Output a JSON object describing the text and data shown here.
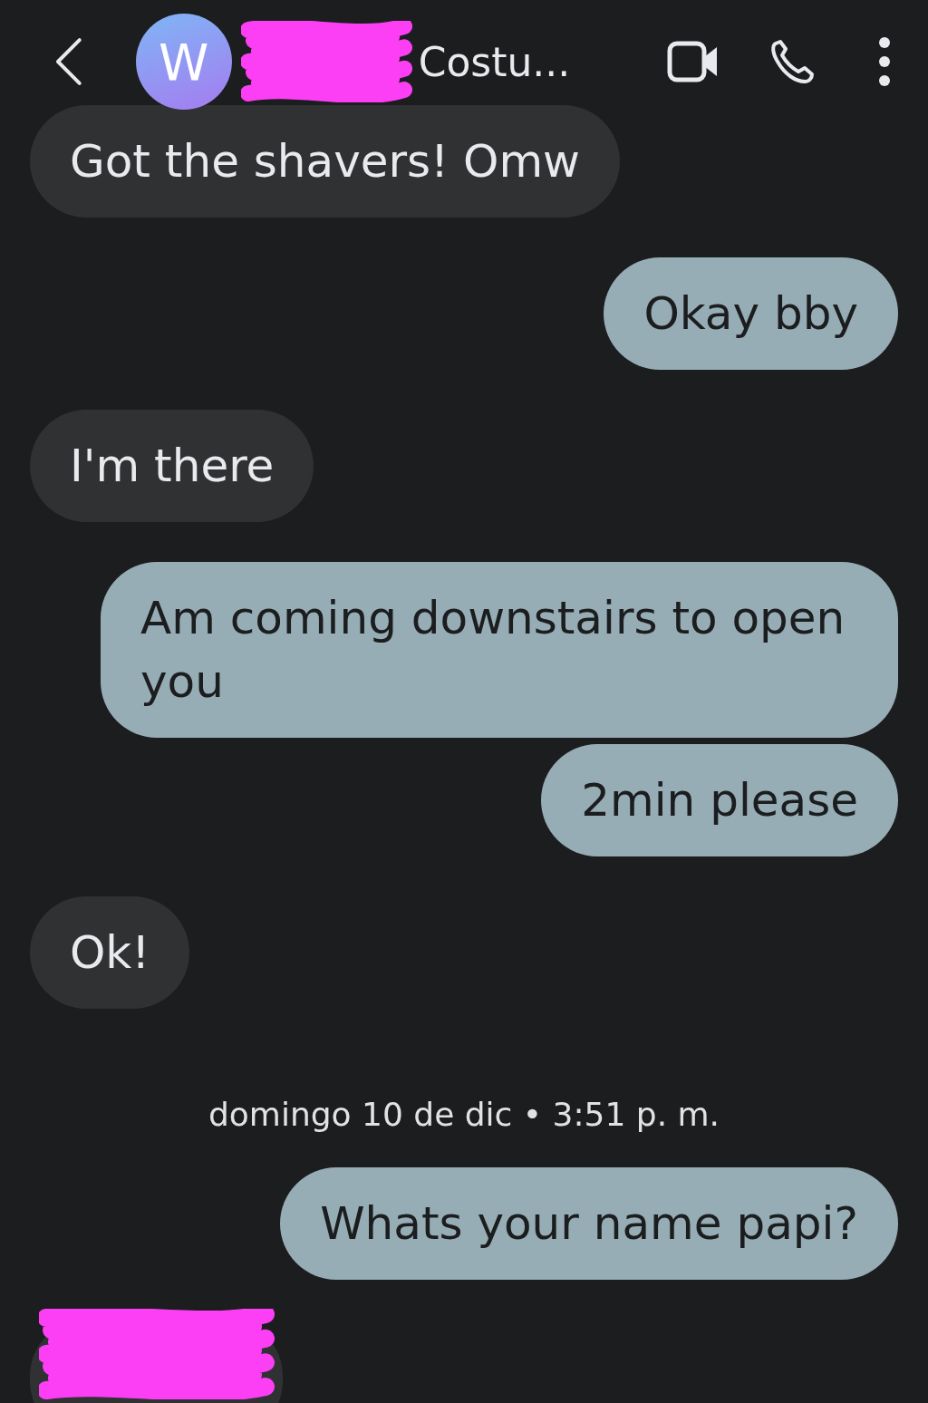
{
  "header": {
    "avatar_letter": "W",
    "title": "Costu...",
    "title_redacted": true
  },
  "messages": [
    {
      "kind": "received",
      "text": "Got the shavers! Omw"
    },
    {
      "kind": "sent",
      "text": "Okay bby"
    },
    {
      "kind": "received",
      "text": "I'm there"
    },
    {
      "kind": "sent",
      "text": "Am coming downstairs to open you"
    },
    {
      "kind": "sent",
      "text": "2min please"
    },
    {
      "kind": "received",
      "text": "Ok!"
    },
    {
      "kind": "date",
      "text": "domingo 10 de dic • 3:51 p. m."
    },
    {
      "kind": "sent",
      "text": "Whats your name papi?"
    },
    {
      "kind": "received",
      "redacted": true
    }
  ]
}
